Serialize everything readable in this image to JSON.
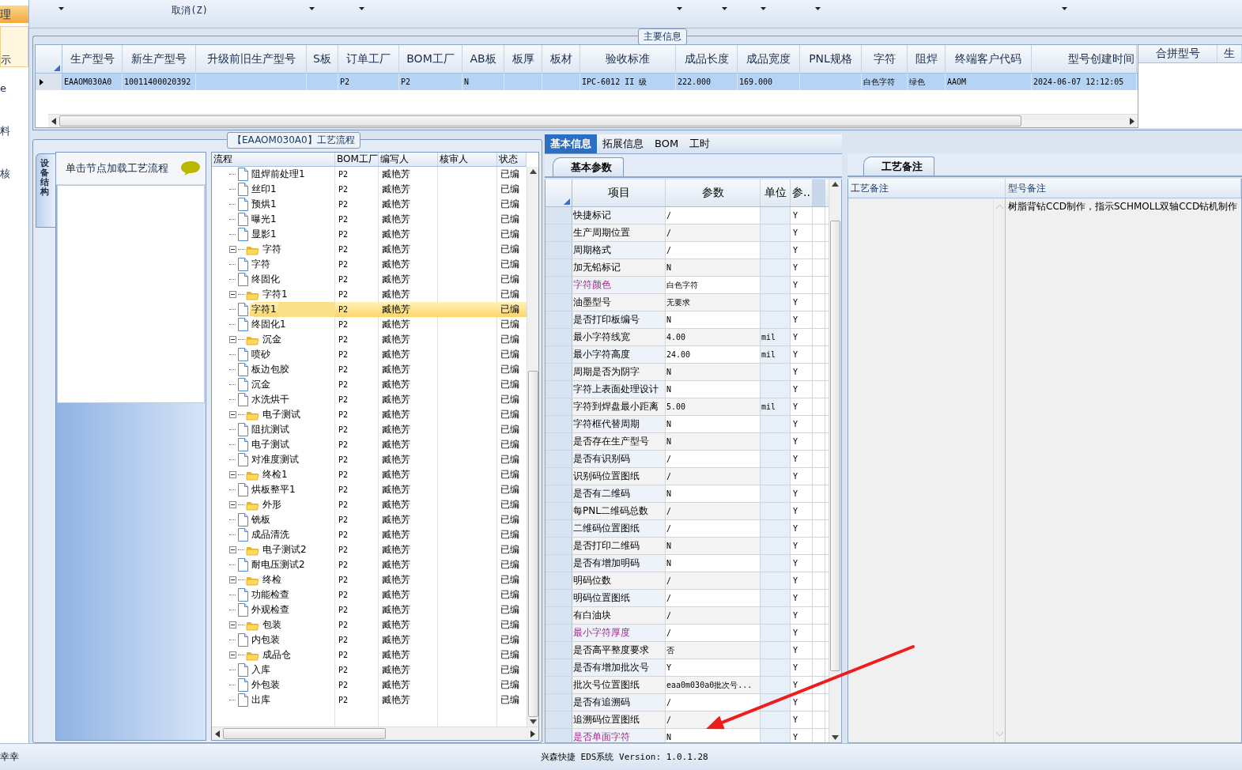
{
  "sidebar": {
    "header": "理",
    "items": [
      {
        "label": "示",
        "selected": true
      },
      {
        "label": "e",
        "selected": false
      },
      {
        "label": "料",
        "selected": false
      },
      {
        "label": "核",
        "selected": false
      }
    ]
  },
  "toolbar": [
    {
      "kind": "dropdown"
    },
    {
      "kind": "label",
      "label": "取消(Z)"
    },
    {
      "kind": "dropdown"
    },
    {
      "kind": "dropdown"
    },
    {
      "kind": "dropdown"
    },
    {
      "kind": "dropdown"
    },
    {
      "kind": "dropdown"
    },
    {
      "kind": "dropdown"
    },
    {
      "kind": "dropdown"
    }
  ],
  "main_info": {
    "title": "主要信息",
    "columns": [
      "生产型号",
      "新生产型号",
      "升级前旧生产型号",
      "S板",
      "订单工厂",
      "BOM工厂",
      "AB板",
      "板厚",
      "板材",
      "验收标准",
      "成品长度",
      "成品宽度",
      "PNL规格",
      "字符",
      "阻焊",
      "终端客户代码",
      "型号创建时间"
    ],
    "rows": [
      {
        "selected": true,
        "cells": [
          "EAAOM030A0",
          "10011400020392",
          null,
          null,
          "P2",
          "P2",
          "N",
          null,
          null,
          "IPC-6012 II 级",
          "222.000",
          "169.000",
          null,
          "白色字符",
          "绿色",
          "AAOM",
          "2024-06-07 12:12:05"
        ]
      }
    ],
    "merge_grid": {
      "columns": [
        "合拼型号",
        "生"
      ]
    }
  },
  "process": {
    "title": "【EAAOM030A0】工艺流程",
    "side_tab": "设备结构",
    "hint": "单击节点加载工艺流程",
    "columns": [
      "流程",
      "BOM工厂",
      "编写人",
      "核审人",
      "状态"
    ],
    "tree": [
      {
        "children": [
          {
            "label": "阻焊前处理1",
            "kind": "step",
            "bom_factory": "P2",
            "writer": "臧艳芳",
            "status": "已编",
            "selected": false
          },
          {
            "label": "丝印1",
            "kind": "step",
            "bom_factory": "P2",
            "writer": "臧艳芳",
            "status": "已编",
            "selected": false
          },
          {
            "label": "预烘1",
            "kind": "step",
            "bom_factory": "P2",
            "writer": "臧艳芳",
            "status": "已编",
            "selected": false
          },
          {
            "label": "曝光1",
            "kind": "step",
            "bom_factory": "P2",
            "writer": "臧艳芳",
            "status": "已编",
            "selected": false
          },
          {
            "label": "显影1",
            "kind": "step",
            "bom_factory": "P2",
            "writer": "臧艳芳",
            "status": "已编",
            "selected": false
          }
        ]
      },
      {
        "label": "字符",
        "kind": "folder",
        "expanded": true,
        "bom_factory": "P2",
        "writer": "臧艳芳",
        "status": "已编",
        "selected": false,
        "children": [
          {
            "label": "字符",
            "kind": "step",
            "bom_factory": "P2",
            "writer": "臧艳芳",
            "status": "已编",
            "selected": false
          },
          {
            "label": "终固化",
            "kind": "step",
            "bom_factory": "P2",
            "writer": "臧艳芳",
            "status": "已编",
            "selected": false
          }
        ]
      },
      {
        "label": "字符1",
        "kind": "folder",
        "expanded": true,
        "bom_factory": "P2",
        "writer": "臧艳芳",
        "status": "已编",
        "selected": false,
        "children": [
          {
            "label": "字符1",
            "kind": "step",
            "bom_factory": "P2",
            "writer": "臧艳芳",
            "status": "已编",
            "selected": true
          },
          {
            "label": "终固化1",
            "kind": "step",
            "bom_factory": "P2",
            "writer": "臧艳芳",
            "status": "已编",
            "selected": false
          }
        ]
      },
      {
        "label": "沉金",
        "kind": "folder",
        "expanded": true,
        "bom_factory": "P2",
        "writer": "臧艳芳",
        "status": "已编",
        "selected": false,
        "children": [
          {
            "label": "喷砂",
            "kind": "step",
            "bom_factory": "P2",
            "writer": "臧艳芳",
            "status": "已编",
            "selected": false
          },
          {
            "label": "板边包胶",
            "kind": "step",
            "bom_factory": "P2",
            "writer": "臧艳芳",
            "status": "已编",
            "selected": false
          },
          {
            "label": "沉金",
            "kind": "step",
            "bom_factory": "P2",
            "writer": "臧艳芳",
            "status": "已编",
            "selected": false
          },
          {
            "label": "水洗烘干",
            "kind": "step",
            "bom_factory": "P2",
            "writer": "臧艳芳",
            "status": "已编",
            "selected": false
          }
        ]
      },
      {
        "label": "电子测试",
        "kind": "folder",
        "expanded": true,
        "bom_factory": "P2",
        "writer": "臧艳芳",
        "status": "已编",
        "selected": false,
        "children": [
          {
            "label": "阻抗测试",
            "kind": "step",
            "bom_factory": "P2",
            "writer": "臧艳芳",
            "status": "已编",
            "selected": false
          },
          {
            "label": "电子测试",
            "kind": "step",
            "bom_factory": "P2",
            "writer": "臧艳芳",
            "status": "已编",
            "selected": false
          },
          {
            "label": "对准度测试",
            "kind": "step",
            "bom_factory": "P2",
            "writer": "臧艳芳",
            "status": "已编",
            "selected": false
          }
        ]
      },
      {
        "label": "终检1",
        "kind": "folder",
        "expanded": true,
        "bom_factory": "P2",
        "writer": "臧艳芳",
        "status": "已编",
        "selected": false,
        "children": [
          {
            "label": "烘板整平1",
            "kind": "step",
            "bom_factory": "P2",
            "writer": "臧艳芳",
            "status": "已编",
            "selected": false
          }
        ]
      },
      {
        "label": "外形",
        "kind": "folder",
        "expanded": true,
        "bom_factory": "P2",
        "writer": "臧艳芳",
        "status": "已编",
        "selected": false,
        "children": [
          {
            "label": "铣板",
            "kind": "step",
            "bom_factory": "P2",
            "writer": "臧艳芳",
            "status": "已编",
            "selected": false
          },
          {
            "label": "成品清洗",
            "kind": "step",
            "bom_factory": "P2",
            "writer": "臧艳芳",
            "status": "已编",
            "selected": false
          }
        ]
      },
      {
        "label": "电子测试2",
        "kind": "folder",
        "expanded": true,
        "bom_factory": "P2",
        "writer": "臧艳芳",
        "status": "已编",
        "selected": false,
        "children": [
          {
            "label": "耐电压测试2",
            "kind": "step",
            "bom_factory": "P2",
            "writer": "臧艳芳",
            "status": "已编",
            "selected": false
          }
        ]
      },
      {
        "label": "终检",
        "kind": "folder",
        "expanded": true,
        "bom_factory": "P2",
        "writer": "臧艳芳",
        "status": "已编",
        "selected": false,
        "children": [
          {
            "label": "功能检查",
            "kind": "step",
            "bom_factory": "P2",
            "writer": "臧艳芳",
            "status": "已编",
            "selected": false
          },
          {
            "label": "外观检查",
            "kind": "step",
            "bom_factory": "P2",
            "writer": "臧艳芳",
            "status": "已编",
            "selected": false
          }
        ]
      },
      {
        "label": "包装",
        "kind": "folder",
        "expanded": true,
        "bom_factory": "P2",
        "writer": "臧艳芳",
        "status": "已编",
        "selected": false,
        "children": [
          {
            "label": "内包装",
            "kind": "step",
            "bom_factory": "P2",
            "writer": "臧艳芳",
            "status": "已编",
            "selected": false
          }
        ]
      },
      {
        "label": "成品仓",
        "kind": "folder",
        "expanded": true,
        "bom_factory": "P2",
        "writer": "臧艳芳",
        "status": "已编",
        "selected": false,
        "children": [
          {
            "label": "入库",
            "kind": "step",
            "bom_factory": "P2",
            "writer": "臧艳芳",
            "status": "已编",
            "selected": false
          },
          {
            "label": "外包装",
            "kind": "step",
            "bom_factory": "P2",
            "writer": "臧艳芳",
            "status": "已编",
            "selected": false
          },
          {
            "label": "出库",
            "kind": "step",
            "bom_factory": "P2",
            "writer": "臧艳芳",
            "status": "已编",
            "selected": false
          }
        ]
      }
    ]
  },
  "detail_tabs": [
    {
      "label": "基本信息",
      "selected": true
    },
    {
      "label": "拓展信息",
      "selected": false
    },
    {
      "label": "BOM",
      "selected": false
    },
    {
      "label": "工时",
      "selected": false
    }
  ],
  "params": {
    "tab": "基本参数",
    "columns": [
      "项目",
      "参数",
      "单位",
      "参.."
    ],
    "rows": [
      {
        "item": "快捷标记",
        "value": "/",
        "flag": "Y",
        "highlighted": false
      },
      {
        "item": "生产周期位置",
        "value": "/",
        "flag": "Y",
        "highlighted": false
      },
      {
        "item": "周期格式",
        "value": "/",
        "flag": "Y",
        "highlighted": false
      },
      {
        "item": "加无铅标记",
        "value": "N",
        "flag": "Y",
        "highlighted": false
      },
      {
        "item": "字符颜色",
        "value": "白色字符",
        "flag": "Y",
        "highlighted": true
      },
      {
        "item": "油墨型号",
        "value": "无要求",
        "flag": "Y",
        "highlighted": false
      },
      {
        "item": "是否打印板编号",
        "value": "N",
        "flag": "Y",
        "highlighted": false
      },
      {
        "item": "最小字符线宽",
        "value": "4.00",
        "unit": "mil",
        "flag": "Y",
        "highlighted": false
      },
      {
        "item": "最小字符高度",
        "value": "24.00",
        "unit": "mil",
        "flag": "Y",
        "highlighted": false
      },
      {
        "item": "周期是否为阴字",
        "value": "N",
        "flag": "Y",
        "highlighted": false
      },
      {
        "item": "字符上表面处理设计",
        "value": "N",
        "flag": "Y",
        "highlighted": false
      },
      {
        "item": "字符到焊盘最小距离",
        "value": "5.00",
        "unit": "mil",
        "flag": "Y",
        "highlighted": false
      },
      {
        "item": "字符框代替周期",
        "value": "N",
        "flag": "Y",
        "highlighted": false
      },
      {
        "item": "是否存在生产型号",
        "value": "N",
        "flag": "Y",
        "highlighted": false
      },
      {
        "item": "是否有识别码",
        "value": "/",
        "flag": "Y",
        "highlighted": false
      },
      {
        "item": "识别码位置图纸",
        "value": "/",
        "flag": "Y",
        "highlighted": false
      },
      {
        "item": "是否有二维码",
        "value": "N",
        "flag": "Y",
        "highlighted": false
      },
      {
        "item": "每PNL二维码总数",
        "value": "/",
        "flag": "Y",
        "highlighted": false
      },
      {
        "item": "二维码位置图纸",
        "value": "/",
        "flag": "Y",
        "highlighted": false
      },
      {
        "item": "是否打印二维码",
        "value": "N",
        "flag": "Y",
        "highlighted": false
      },
      {
        "item": "是否有增加明码",
        "value": "N",
        "flag": "Y",
        "highlighted": false
      },
      {
        "item": "明码位数",
        "value": "/",
        "flag": "Y",
        "highlighted": false
      },
      {
        "item": "明码位置图纸",
        "value": "/",
        "flag": "Y",
        "highlighted": false
      },
      {
        "item": "有白油块",
        "value": "/",
        "flag": "Y",
        "highlighted": false
      },
      {
        "item": "最小字符厚度",
        "value": "/",
        "flag": "Y",
        "highlighted": true
      },
      {
        "item": "是否高平整度要求",
        "value": "否",
        "flag": "Y",
        "highlighted": false
      },
      {
        "item": "是否有增加批次号",
        "value": "Y",
        "flag": "Y",
        "highlighted": false
      },
      {
        "item": "批次号位置图纸",
        "value": "eaa0m030a0批次号...",
        "flag": "Y",
        "highlighted": false
      },
      {
        "item": "是否有追溯码",
        "value": "/",
        "flag": "Y",
        "highlighted": false
      },
      {
        "item": "追溯码位置图纸",
        "value": "/",
        "flag": "Y",
        "highlighted": false
      },
      {
        "item": "是否单面字符",
        "value": "N",
        "flag": "Y",
        "highlighted": true
      }
    ]
  },
  "notes": {
    "tab": "工艺备注",
    "columns": [
      "工艺备注",
      "型号备注"
    ],
    "model_note": "树脂背钻CCD制作，指示SCHMOLL双轴CCD钻机制作"
  },
  "status_bar": {
    "left": "幸幸",
    "center": "兴森快捷 EDS系统 Version: 1.0.1.28"
  }
}
